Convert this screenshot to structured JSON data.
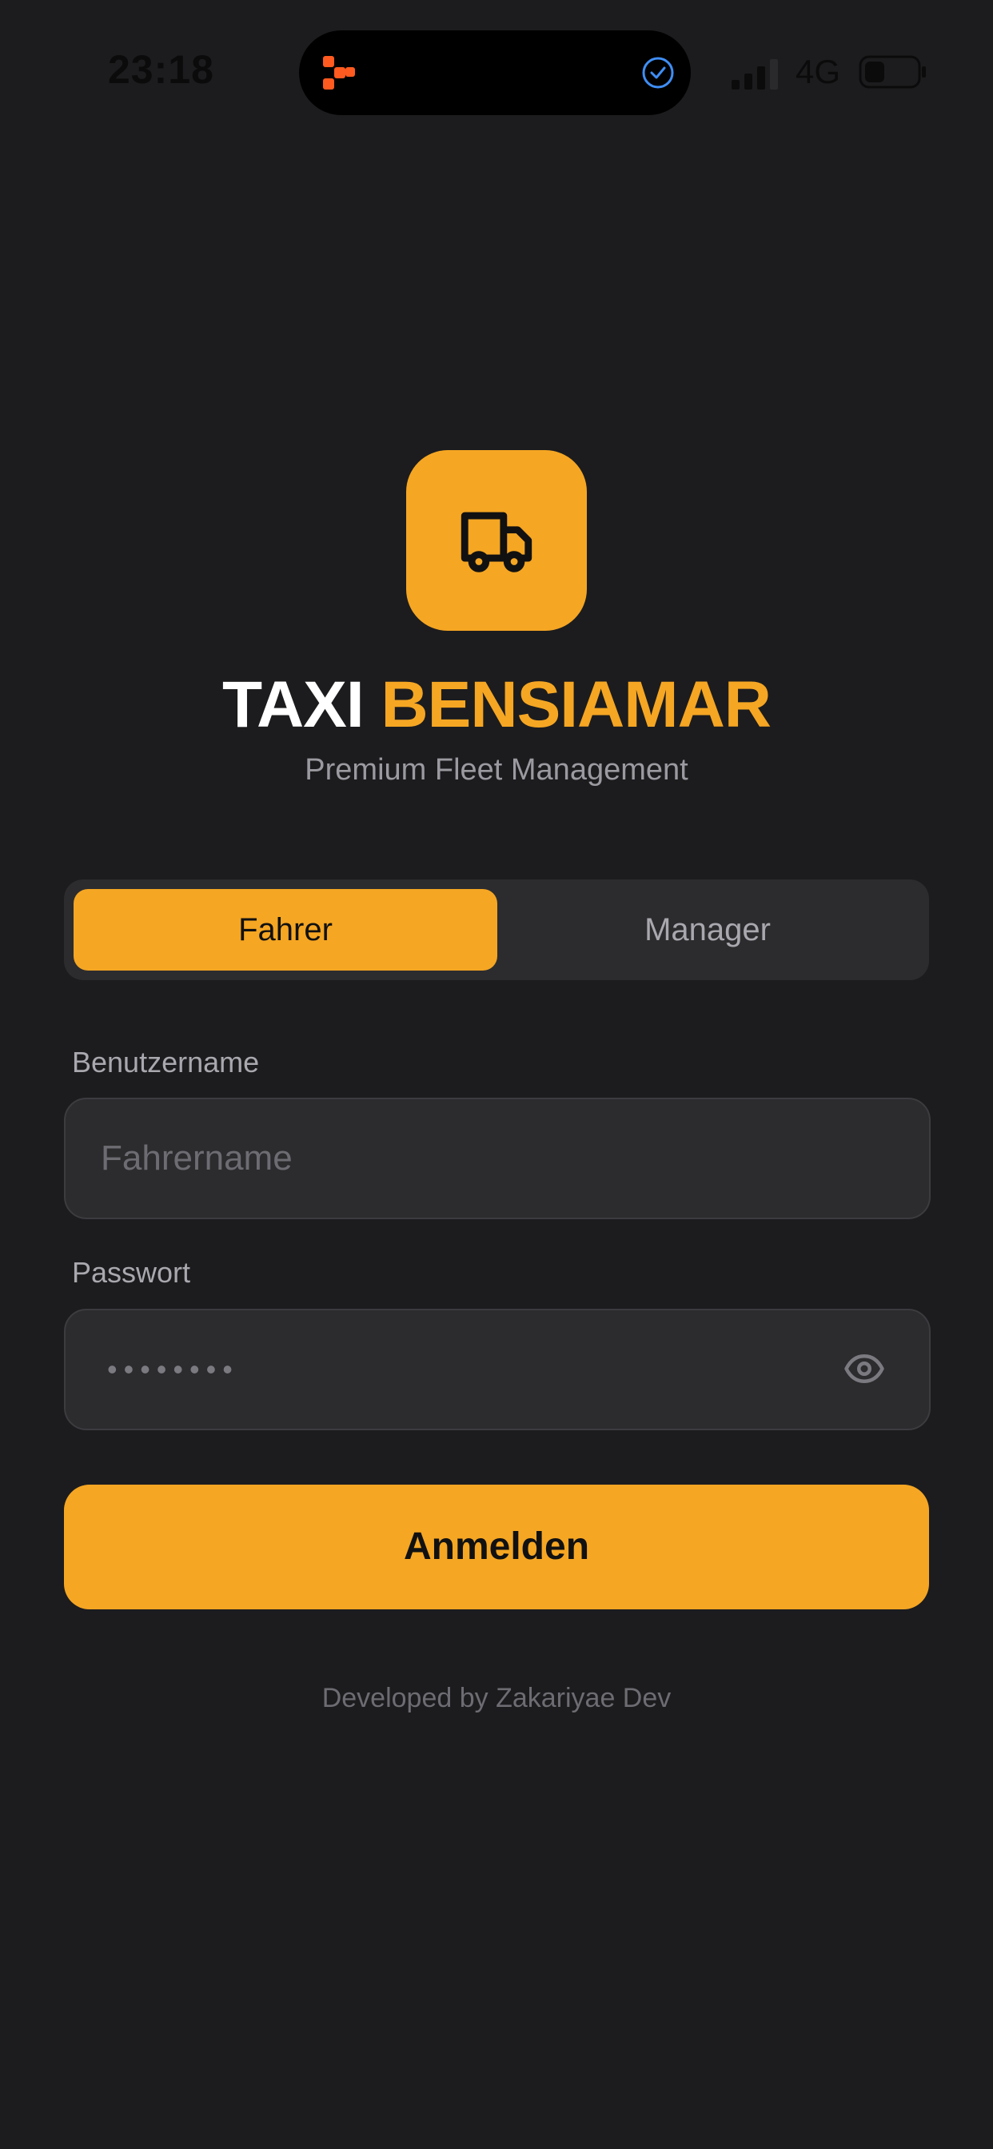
{
  "status_bar": {
    "time": "23:18",
    "network": "4G",
    "signal_icon": "signal-bars-icon",
    "battery_icon": "battery-icon"
  },
  "dynamic_island": {
    "app_icon": "app-logo-icon",
    "status_icon": "checkmark-circle-icon"
  },
  "brand": {
    "icon": "truck-icon",
    "title_part1": "TAXI",
    "title_part2": "BENSIAMAR",
    "subtitle": "Premium Fleet Management"
  },
  "role_switch": {
    "options": [
      {
        "label": "Fahrer",
        "selected": true
      },
      {
        "label": "Manager",
        "selected": false
      }
    ]
  },
  "form": {
    "username_label": "Benutzername",
    "username_placeholder": "Fahrername",
    "username_value": "",
    "password_label": "Passwort",
    "password_masked": "••••••••",
    "password_toggle_icon": "eye-icon",
    "submit_label": "Anmelden"
  },
  "footer": {
    "credit": "Developed by Zakariyae Dev"
  },
  "colors": {
    "background": "#1c1c1e",
    "accent": "#f5a623",
    "surface": "#2c2c2e",
    "muted_text": "#a8a8ae"
  }
}
